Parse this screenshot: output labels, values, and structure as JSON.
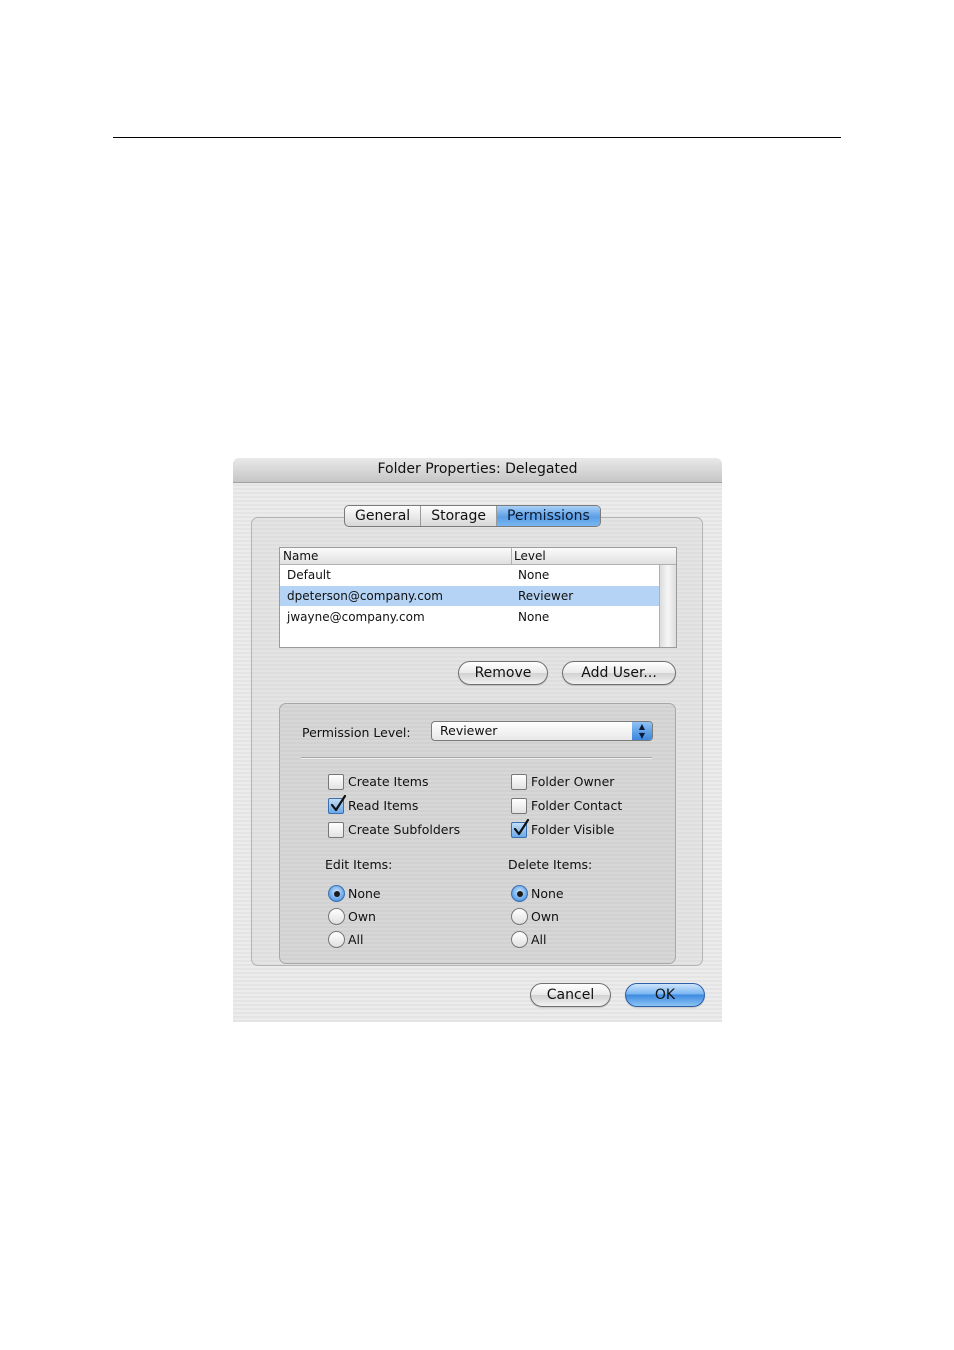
{
  "dialog": {
    "title": "Folder Properties: Delegated",
    "tabs": [
      {
        "label": "General",
        "active": false
      },
      {
        "label": "Storage",
        "active": false
      },
      {
        "label": "Permissions",
        "active": true
      }
    ],
    "user_list": {
      "columns": [
        "Name",
        "Level"
      ],
      "rows": [
        {
          "name": "Default",
          "level": "None",
          "selected": false
        },
        {
          "name": "dpeterson@company.com",
          "level": "Reviewer",
          "selected": true
        },
        {
          "name": "jwayne@company.com",
          "level": "None",
          "selected": false
        }
      ]
    },
    "buttons": {
      "remove": "Remove",
      "add_user": "Add User...",
      "cancel": "Cancel",
      "ok": "OK"
    },
    "permissions": {
      "level_label": "Permission Level:",
      "level_value": "Reviewer",
      "checkboxes": {
        "create_items": {
          "label": "Create Items",
          "checked": false
        },
        "read_items": {
          "label": "Read Items",
          "checked": true
        },
        "create_subfolders": {
          "label": "Create Subfolders",
          "checked": false
        },
        "folder_owner": {
          "label": "Folder Owner",
          "checked": false
        },
        "folder_contact": {
          "label": "Folder Contact",
          "checked": false
        },
        "folder_visible": {
          "label": "Folder Visible",
          "checked": true
        }
      },
      "edit_items": {
        "label": "Edit Items:",
        "options": [
          "None",
          "Own",
          "All"
        ],
        "selected": "None"
      },
      "delete_items": {
        "label": "Delete Items:",
        "options": [
          "None",
          "Own",
          "All"
        ],
        "selected": "None"
      }
    }
  },
  "colors": {
    "selection": "#b5d3f5",
    "accent_blue": "#3d8ae0"
  }
}
